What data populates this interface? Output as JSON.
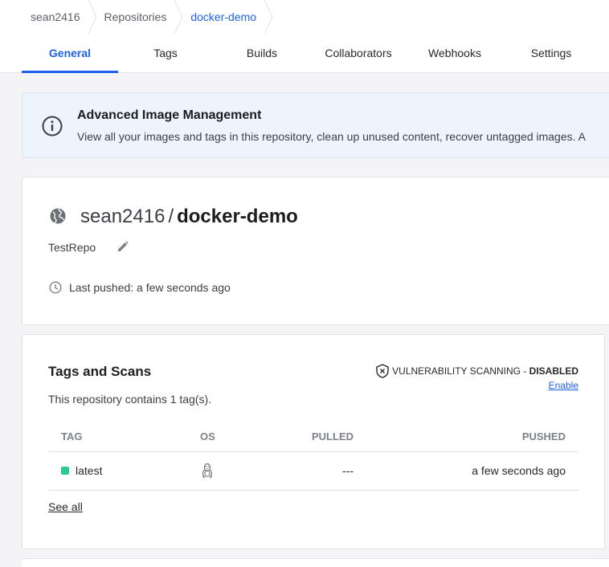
{
  "breadcrumb": {
    "items": [
      {
        "label": "sean2416"
      },
      {
        "label": "Repositories"
      },
      {
        "label": "docker-demo"
      }
    ]
  },
  "tabs": [
    {
      "label": "General",
      "active": true
    },
    {
      "label": "Tags"
    },
    {
      "label": "Builds"
    },
    {
      "label": "Collaborators"
    },
    {
      "label": "Webhooks"
    },
    {
      "label": "Settings"
    }
  ],
  "banner": {
    "title": "Advanced Image Management",
    "text": "View all your images and tags in this repository, clean up unused content, recover untagged images. A",
    "icon": "info-icon"
  },
  "repo": {
    "namespace": "sean2416",
    "slash": "/",
    "name": "docker-demo",
    "description": "TestRepo",
    "last_pushed": "Last pushed: a few seconds ago",
    "visibility_icon": "globe-icon"
  },
  "tags_section": {
    "title": "Tags and Scans",
    "subtitle": "This repository contains 1 tag(s).",
    "vuln_label": "VULNERABILITY SCANNING - ",
    "vuln_status": "DISABLED",
    "vuln_enable": "Enable",
    "columns": [
      "TAG",
      "OS",
      "PULLED",
      "PUSHED"
    ],
    "rows": [
      {
        "tag": "latest",
        "os": "linux-icon",
        "pulled": "---",
        "pushed": "a few seconds ago"
      }
    ],
    "see_all": "See all"
  },
  "colors": {
    "accent": "#1d63ed",
    "tag_status": "#2ec98e"
  }
}
